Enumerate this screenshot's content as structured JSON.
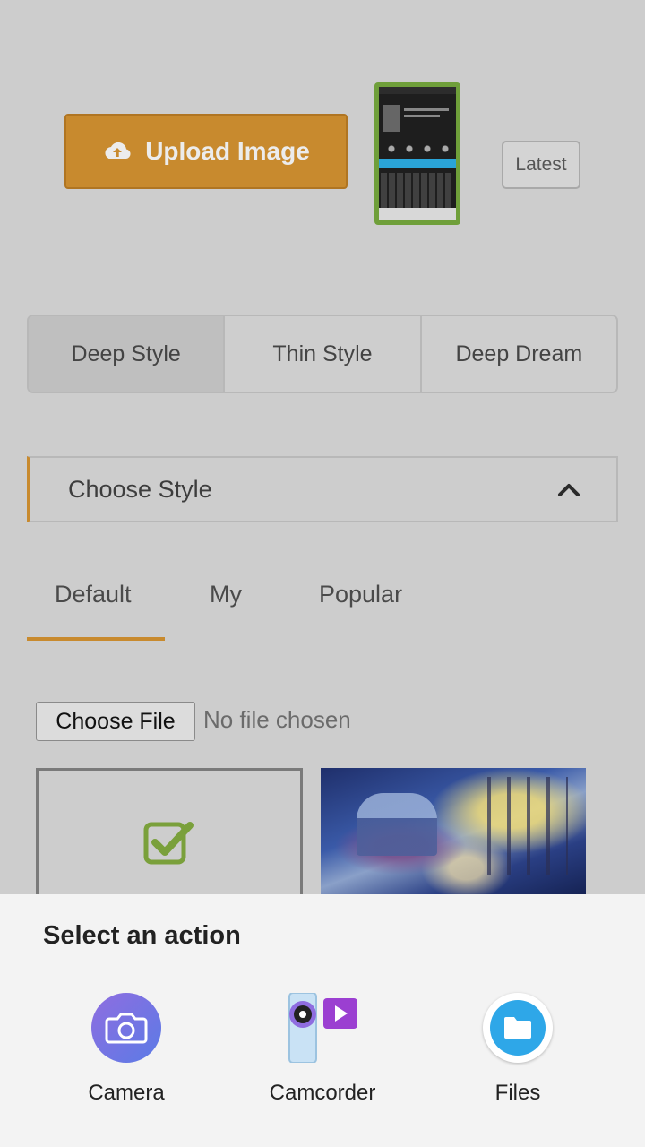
{
  "header": {
    "upload_label": "Upload Image",
    "latest_label": "Latest"
  },
  "styles": {
    "segments": [
      "Deep Style",
      "Thin Style",
      "Deep Dream"
    ],
    "active_index": 0
  },
  "choose_style": {
    "label": "Choose Style"
  },
  "tabs": [
    "Default",
    "My",
    "Popular"
  ],
  "file_input": {
    "button_label": "Choose File",
    "status": "No file chosen"
  },
  "sheet": {
    "title": "Select an action",
    "actions": [
      "Camera",
      "Camcorder",
      "Files"
    ]
  },
  "colors": {
    "accent": "#c88a2e",
    "background": "#cdcdcd",
    "check": "#7aa03b"
  }
}
